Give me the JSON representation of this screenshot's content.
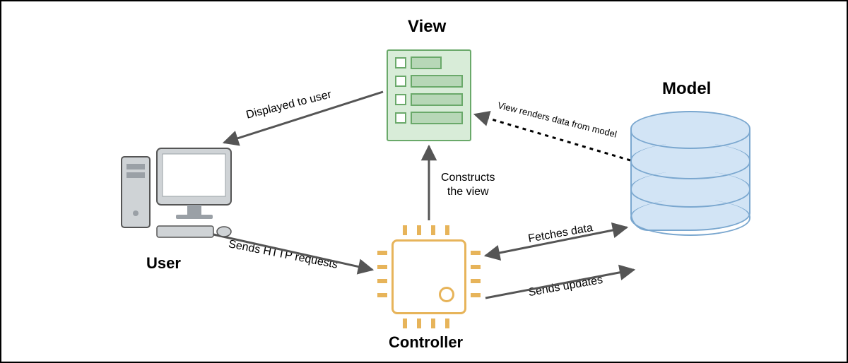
{
  "nodes": {
    "view": {
      "label": "View"
    },
    "model": {
      "label": "Model"
    },
    "controller": {
      "label": "Controller"
    },
    "user": {
      "label": "User"
    }
  },
  "edges": {
    "view_to_user": {
      "label": "Displayed to user"
    },
    "user_to_controller": {
      "label": "Sends HTTP requests"
    },
    "controller_to_view": {
      "label": "Constructs\nthe view"
    },
    "controller_model_fetch": {
      "label": "Fetches data"
    },
    "controller_to_model_upd": {
      "label": "Sends updates"
    },
    "model_to_view": {
      "label": "View renders data from model"
    }
  }
}
